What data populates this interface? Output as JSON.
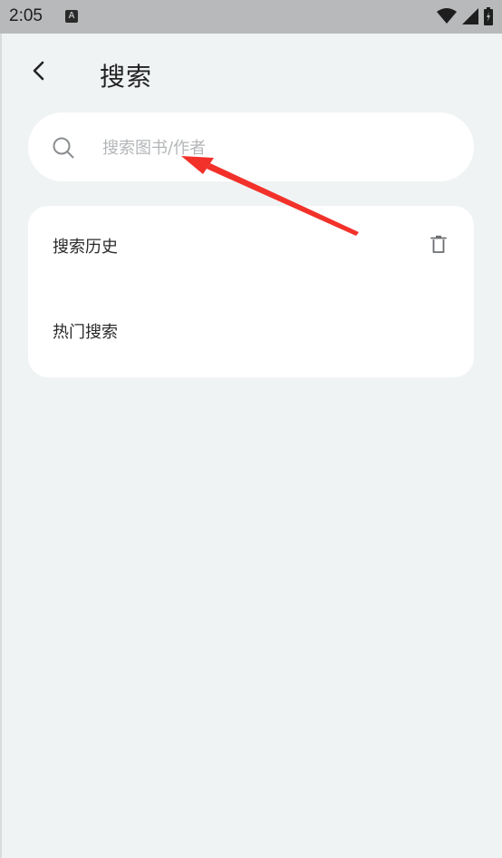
{
  "status_bar": {
    "time": "2:05",
    "notification_icon": "a-notification-icon",
    "wifi_icon": "wifi-icon",
    "signal_icon": "signal-icon",
    "battery_icon": "battery-charging-icon"
  },
  "header": {
    "back_icon": "chevron-left-icon",
    "title": "搜索"
  },
  "search": {
    "icon": "search-icon",
    "placeholder": "搜索图书/作者",
    "value": ""
  },
  "sections": {
    "history_title": "搜索历史",
    "delete_icon": "trash-icon",
    "hot_title": "热门搜索"
  },
  "annotation": {
    "arrow_color": "#f2312a"
  },
  "colors": {
    "background": "#f0f3f4",
    "card": "#ffffff",
    "status_bar": "#b7b9ba"
  }
}
